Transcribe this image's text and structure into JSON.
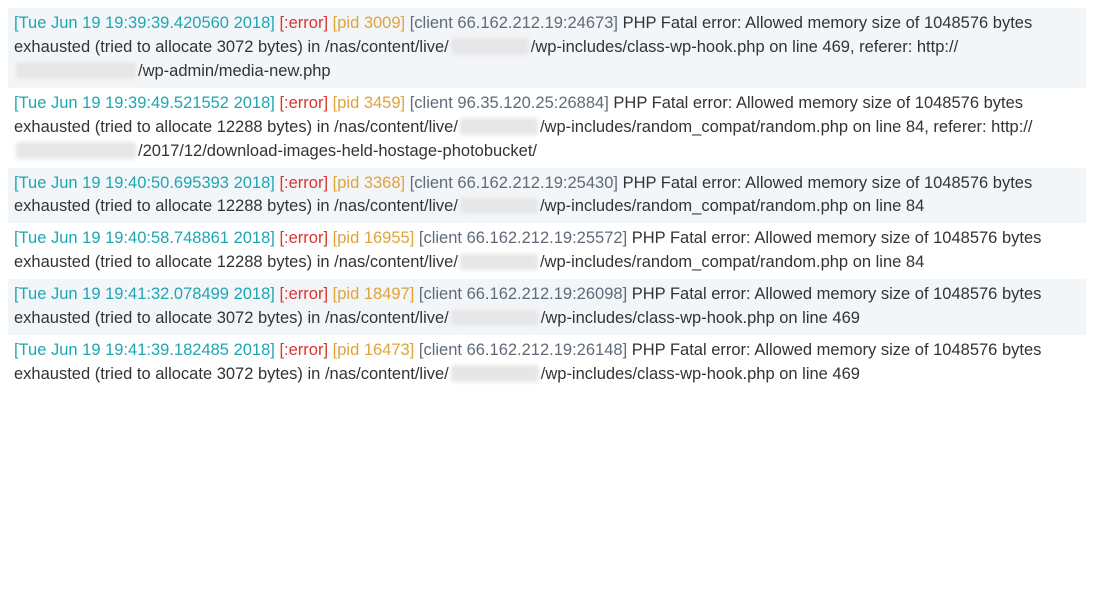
{
  "logs": [
    {
      "timestamp": "[Tue Jun 19 19:39:39.420560 2018]",
      "level": "[:error]",
      "pid": "[pid 3009]",
      "client": "[client 66.162.212.19:24673]",
      "msg_parts": [
        " PHP Fatal error: Allowed memory size of 1048576 bytes exhausted (tried to allocate 3072 bytes) in /nas/content/live/",
        "/wp-includes/class-wp-hook.php on line 469, referer: http://",
        "/wp-admin/media-new.php"
      ],
      "redactions": [
        78,
        120
      ]
    },
    {
      "timestamp": "[Tue Jun 19 19:39:49.521552 2018]",
      "level": "[:error]",
      "pid": "[pid 3459]",
      "client": "[client 96.35.120.25:26884]",
      "msg_parts": [
        " PHP Fatal error: Allowed memory size of 1048576 bytes exhausted (tried to allocate 12288 bytes) in /nas/content/live/",
        "/wp-includes/random_compat/random.php on line 84, referer: http://",
        "/2017/12/download-images-held-hostage-photobucket/"
      ],
      "redactions": [
        78,
        120
      ]
    },
    {
      "timestamp": "[Tue Jun 19 19:40:50.695393 2018]",
      "level": "[:error]",
      "pid": "[pid 3368]",
      "client": "[client 66.162.212.19:25430]",
      "msg_parts": [
        " PHP Fatal error: Allowed memory size of 1048576 bytes exhausted (tried to allocate 12288 bytes) in /nas/content/live/",
        "/wp-includes/random_compat/random.php on line 84"
      ],
      "redactions": [
        78
      ]
    },
    {
      "timestamp": "[Tue Jun 19 19:40:58.748861 2018]",
      "level": "[:error]",
      "pid": "[pid 16955]",
      "client": "[client 66.162.212.19:25572]",
      "msg_parts": [
        " PHP Fatal error: Allowed memory size of 1048576 bytes exhausted (tried to allocate 12288 bytes) in /nas/content/live/",
        "/wp-includes/random_compat/random.php on line 84"
      ],
      "redactions": [
        78
      ]
    },
    {
      "timestamp": "[Tue Jun 19 19:41:32.078499 2018]",
      "level": "[:error]",
      "pid": "[pid 18497]",
      "client": "[client 66.162.212.19:26098]",
      "msg_parts": [
        " PHP Fatal error: Allowed memory size of 1048576 bytes exhausted (tried to allocate 3072 bytes) in /nas/content/live/",
        "/wp-includes/class-wp-hook.php on line 469"
      ],
      "redactions": [
        88
      ]
    },
    {
      "timestamp": "[Tue Jun 19 19:41:39.182485 2018]",
      "level": "[:error]",
      "pid": "[pid 16473]",
      "client": "[client 66.162.212.19:26148]",
      "msg_parts": [
        " PHP Fatal error: Allowed memory size of 1048576 bytes exhausted (tried to allocate 3072 bytes) in /nas/content/live/",
        "/wp-includes/class-wp-hook.php on line 469"
      ],
      "redactions": [
        88
      ]
    }
  ]
}
